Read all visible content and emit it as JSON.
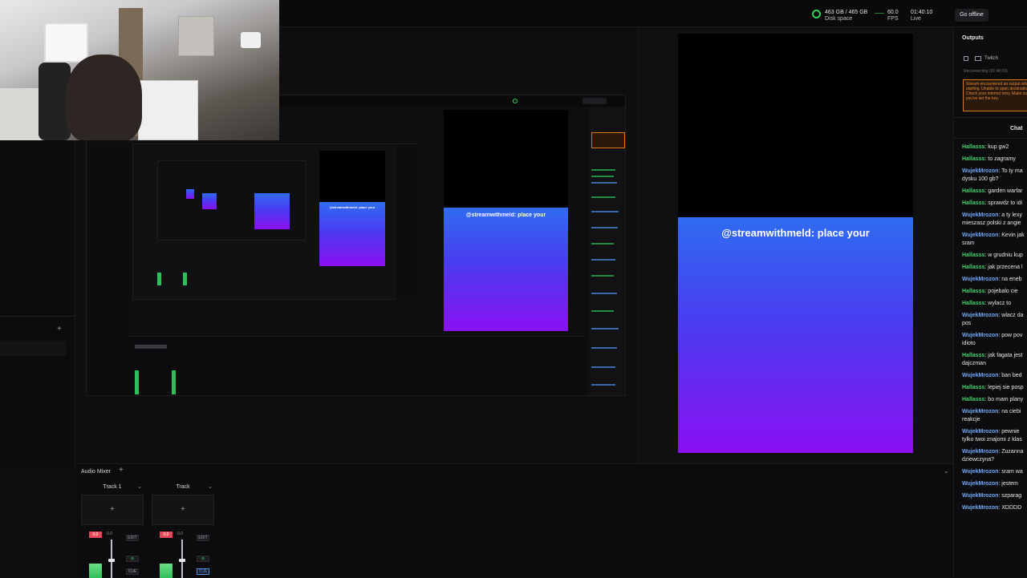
{
  "topbar": {
    "disk_value": "463 GB / 465 GB",
    "disk_label": "Disk space",
    "fps_value": "60.0",
    "fps_label": "FPS",
    "time_value": "01:40:10",
    "time_label": "Live",
    "go_offline": "Go offline"
  },
  "canvas": {
    "overlay_text": "@streamwithmeld: place your"
  },
  "mixer": {
    "title": "Audio Mixer",
    "add": "+",
    "tracks": [
      {
        "name": "Track 1",
        "level": "0.0",
        "edit": "EDIT",
        "cue": "CUE"
      },
      {
        "name": "Track",
        "level": "0.0",
        "edit": "EDIT",
        "cue": "CUE"
      }
    ]
  },
  "outputs": {
    "title": "Outputs",
    "twitch_label": "Twitch",
    "status": "Reconnecting (01:40:09)",
    "warning": "Stream encountered an output while starting. Unable to open destination. Check your internet retry. Make sure you've set the key."
  },
  "chat": {
    "title": "Chat",
    "messages": [
      {
        "user": "Hallasss",
        "text": ": kup gw2"
      },
      {
        "user": "Hallasss",
        "text": ": to zagramy"
      },
      {
        "user": "WujekMrozon",
        "text": ": To ty ma dysku 100 gb?"
      },
      {
        "user": "Hallasss",
        "text": ": garden warfar"
      },
      {
        "user": "Hallasss",
        "text": ": sprawdz to idi"
      },
      {
        "user": "WujekMrozon",
        "text": ": a ty lexy mieszasz polski z angie"
      },
      {
        "user": "WujekMrozon",
        "text": ": Kevin jak sram"
      },
      {
        "user": "Hallasss",
        "text": ": w grudniu kup"
      },
      {
        "user": "Hallasss",
        "text": ": jak przecena l"
      },
      {
        "user": "WujekMrozon",
        "text": ": na eneb"
      },
      {
        "user": "Hallasss",
        "text": ": pojebalo cie"
      },
      {
        "user": "Hallasss",
        "text": ": wylacz to"
      },
      {
        "user": "WujekMrozon",
        "text": ": wlacz da pos"
      },
      {
        "user": "WujekMrozon",
        "text": ": pow pov idioto"
      },
      {
        "user": "Hallasss",
        "text": ": jak fagata jest dajczman"
      },
      {
        "user": "WujekMrozon",
        "text": ": ban bed"
      },
      {
        "user": "Hallasss",
        "text": ": lepiej sie posp"
      },
      {
        "user": "Hallasss",
        "text": ": bo mam plany"
      },
      {
        "user": "WujekMrozon",
        "text": ": na ciebi reakcje"
      },
      {
        "user": "WujekMrozon",
        "text": ": pewnie tylko twoi znajomi z klas"
      },
      {
        "user": "WujekMrozon",
        "text": ": Zuzanna dziewczyna?"
      },
      {
        "user": "WujekMrozon",
        "text": ": sram wa"
      },
      {
        "user": "WujekMrozon",
        "text": ": jestem"
      },
      {
        "user": "WujekMrozon",
        "text": ": szparag"
      },
      {
        "user": "WujekMrozon",
        "text": ": XDDDD"
      }
    ]
  },
  "colors": {
    "accent_green": "#2fd35a",
    "hallasss_color": "#49d36b",
    "wujek_color": "#6fa9f5",
    "gradient_top": "#2f6cf0",
    "gradient_bottom": "#8a10f2",
    "warning_orange": "#d9781f"
  }
}
